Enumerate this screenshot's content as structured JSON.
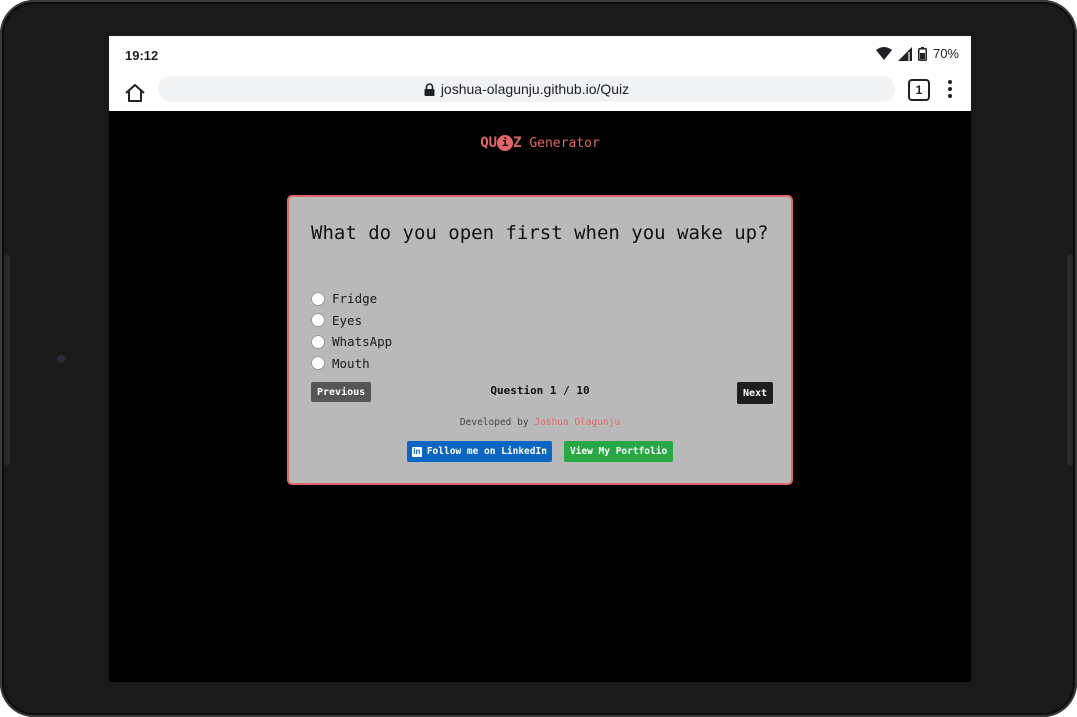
{
  "status_bar": {
    "time": "19:12",
    "battery": "70%",
    "icons": [
      "wifi-icon",
      "signal-icon",
      "battery-icon"
    ]
  },
  "browser": {
    "url": "joshua-olagunju.github.io/Quiz",
    "tab_count": "1",
    "icons": [
      "home-icon",
      "lock-icon",
      "more-vert-icon"
    ]
  },
  "brand": {
    "prefix": "QU",
    "i_letter": "i",
    "suffix": "Z",
    "tagline": "Generator"
  },
  "quiz": {
    "question": "What do you open first when you wake up?",
    "options": [
      "Fridge",
      "Eyes",
      "WhatsApp",
      "Mouth"
    ],
    "previous_label": "Previous",
    "next_label": "Next",
    "counter": "Question 1 / 10"
  },
  "footer": {
    "developed_by": "Developed by",
    "author": "Joshua Olagunju",
    "linkedin_label": "Follow me on LinkedIn",
    "linkedin_icon_text": "in",
    "portfolio_label": "View My Portfolio"
  },
  "colors": {
    "accent": "#e06666",
    "card_bg": "#b9b9b9",
    "page_bg": "#000000",
    "linkedin": "#0a66c2",
    "portfolio": "#28a745"
  }
}
